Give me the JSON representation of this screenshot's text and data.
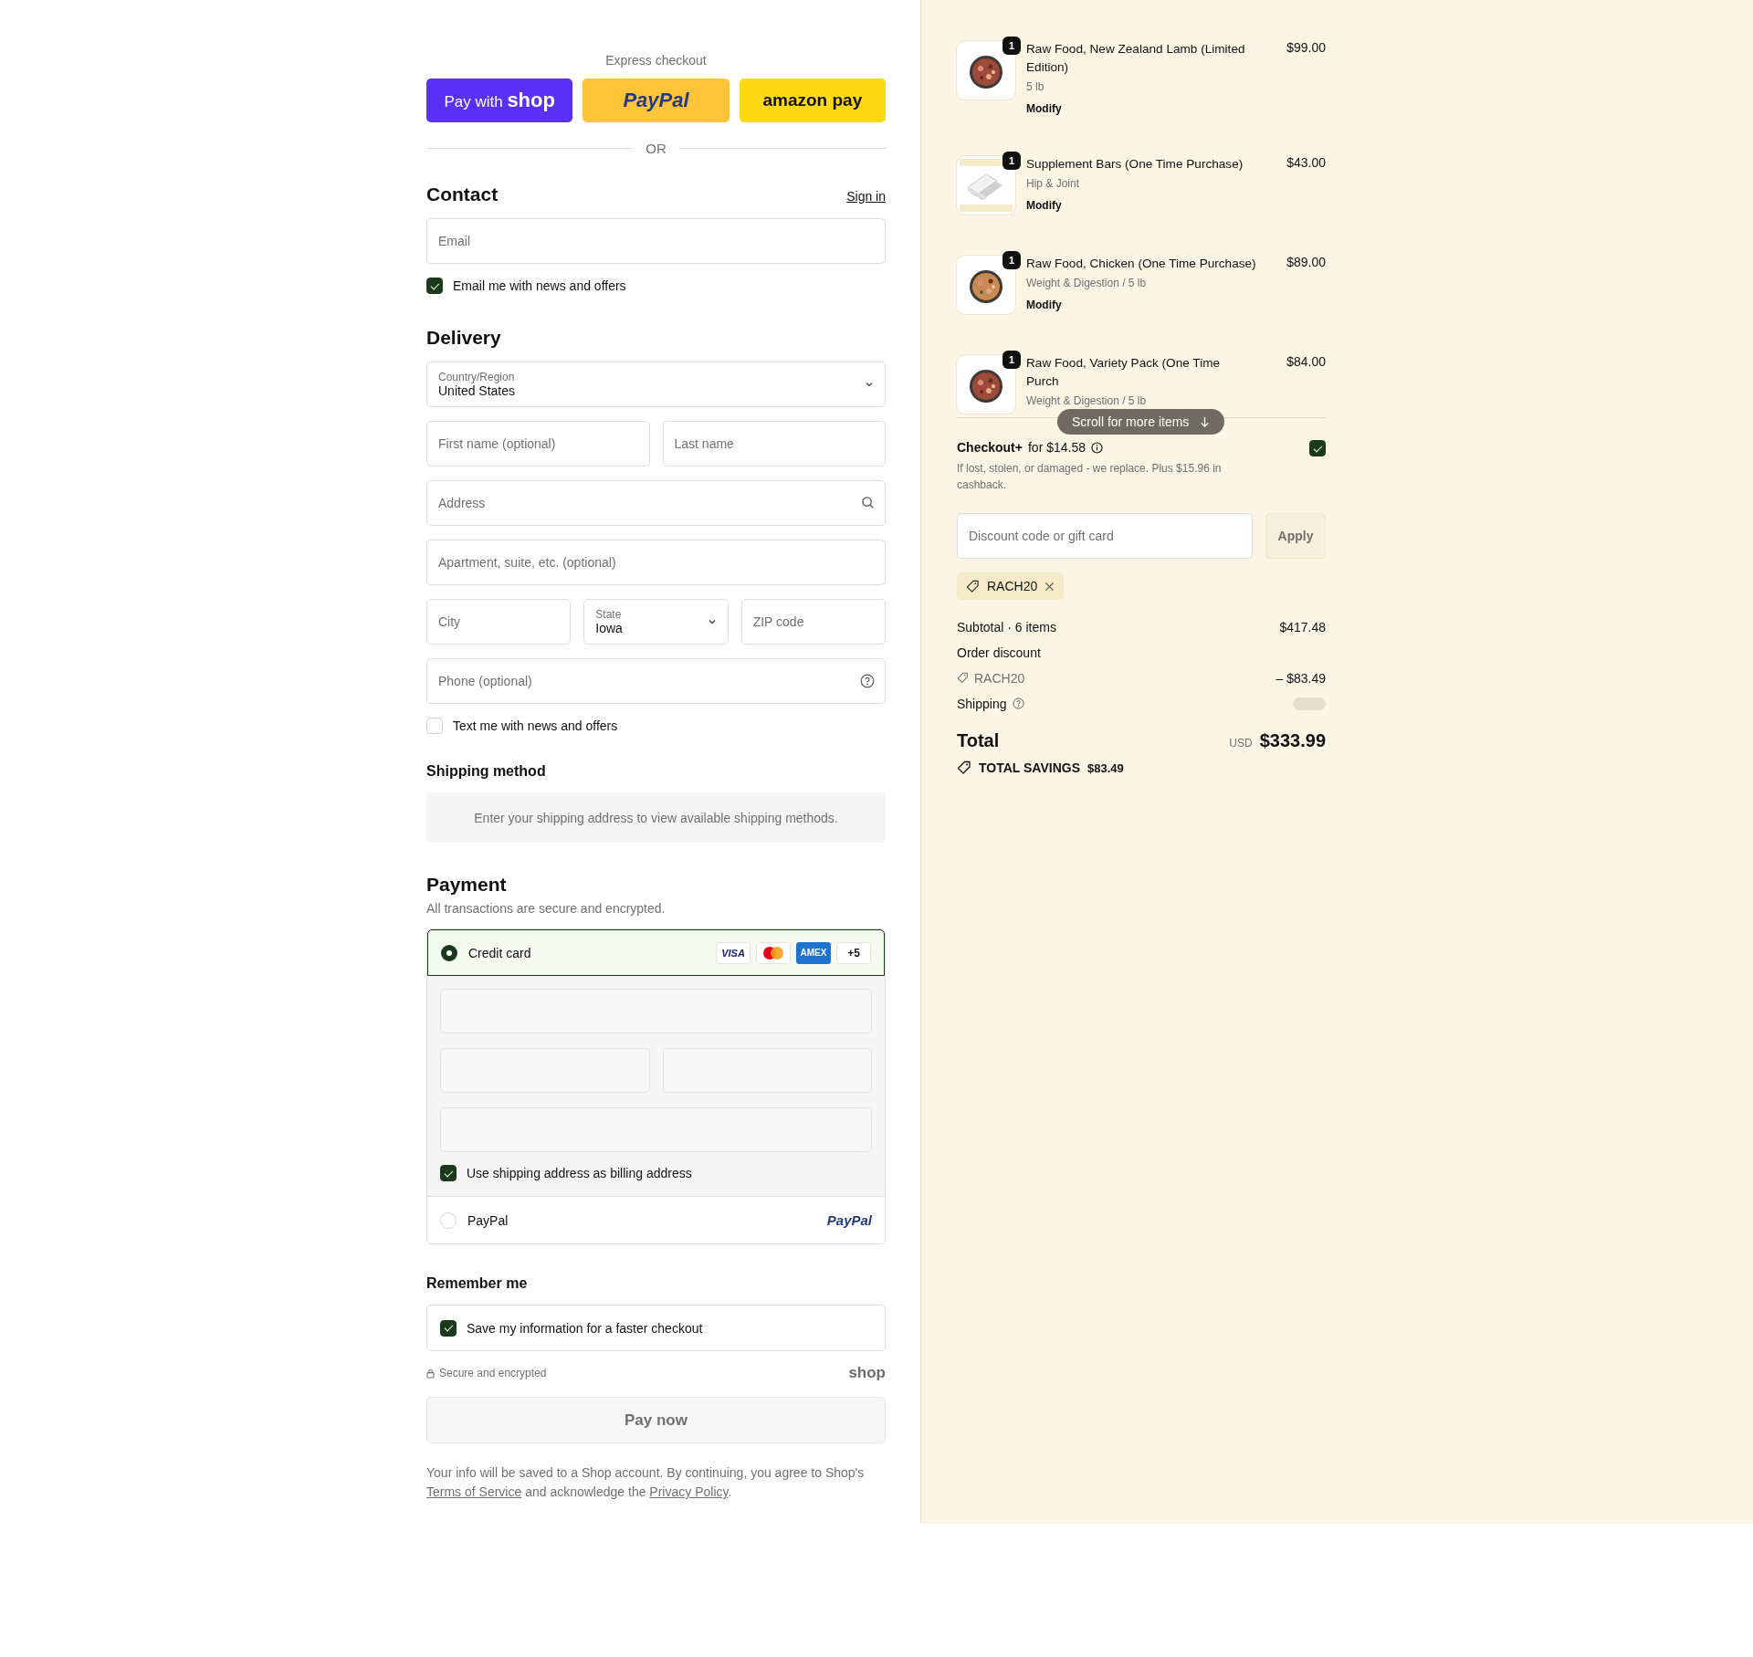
{
  "express": {
    "label": "Express checkout",
    "buttons": [
      {
        "kind": "shop",
        "text": "Pay with",
        "brand": "shop"
      },
      {
        "kind": "paypal",
        "text": "PayPal"
      },
      {
        "kind": "amazon",
        "text": "amazon pay"
      }
    ],
    "divider": "OR"
  },
  "contact": {
    "title": "Contact",
    "link": "Sign in",
    "email": {
      "placeholder": "Email"
    },
    "news": {
      "label": "Email me with news and offers",
      "checked": true
    }
  },
  "delivery": {
    "title": "Delivery",
    "rows": [
      [
        {
          "kind": "select",
          "label": "Country/Region",
          "value": "United States"
        }
      ],
      [
        {
          "kind": "text",
          "placeholder": "First name (optional)"
        },
        {
          "kind": "text",
          "placeholder": "Last name"
        }
      ],
      [
        {
          "kind": "search",
          "placeholder": "Address"
        }
      ],
      [
        {
          "kind": "text",
          "placeholder": "Apartment, suite, etc. (optional)"
        }
      ],
      [
        {
          "kind": "text",
          "placeholder": "City"
        },
        {
          "kind": "select",
          "label": "State",
          "value": "Iowa"
        },
        {
          "kind": "text",
          "placeholder": "ZIP code"
        }
      ],
      [
        {
          "kind": "help",
          "placeholder": "Phone (optional)"
        }
      ]
    ],
    "sms": {
      "label": "Text me with news and offers",
      "checked": false
    }
  },
  "shipping_method": {
    "title": "Shipping method",
    "notice": "Enter your shipping address to view available shipping methods."
  },
  "payment": {
    "title": "Payment",
    "subtitle": "All transactions are secure and encrypted.",
    "methods": [
      {
        "kind": "card",
        "label": "Credit card",
        "selected": true,
        "badges": [
          {
            "kind": "visa",
            "text": "VISA"
          },
          {
            "kind": "mastercard"
          },
          {
            "kind": "amex",
            "text": "AMEX"
          },
          {
            "kind": "more",
            "text": "+5"
          }
        ],
        "billing": {
          "label": "Use shipping address as billing address",
          "checked": true
        }
      },
      {
        "kind": "paypal",
        "label": "PayPal",
        "selected": false,
        "logo": "PayPal"
      }
    ]
  },
  "remember": {
    "title": "Remember me",
    "save": {
      "label": "Save my information for a faster checkout",
      "checked": true
    },
    "secure": "Secure and encrypted",
    "brand": "shop"
  },
  "pay_button": {
    "label": "Pay now",
    "disabled": true
  },
  "legal": {
    "before": "Your info will be saved to a Shop account. By continuing, you agree to Shop's",
    "terms": "Terms of Service",
    "middle": "and acknowledge the",
    "privacy": "Privacy Policy",
    "after": "."
  },
  "summary": {
    "items": [
      {
        "quantity": "1",
        "name": "Raw Food, New Zealand Lamb (Limited Edition)",
        "variant": "5 lb",
        "action": "Modify",
        "price": "$99.00"
      },
      {
        "quantity": "1",
        "name": "Supplement Bars (One Time Purchase)",
        "variant": "Hip & Joint",
        "action": "Modify",
        "price": "$43.00"
      },
      {
        "quantity": "1",
        "name": "Raw Food, Chicken (One Time Purchase)",
        "variant": "Weight & Digestion / 5 lb",
        "action": "Modify",
        "price": "$89.00"
      },
      {
        "quantity": "1",
        "name": "Raw Food, Variety Pack (One Time Purch",
        "variant": "Weight & Digestion / 5 lb",
        "price": "$84.00"
      }
    ],
    "scroll_hint": "Scroll for more items",
    "protection": {
      "name": "Checkout+",
      "price": "for $14.58",
      "description": "If lost, stolen, or damaged - we replace. Plus $15.96 in cashback.",
      "checked": true
    },
    "discount": {
      "placeholder": "Discount code or gift card",
      "button": "Apply"
    },
    "applied_code": "RACH20",
    "lines": [
      {
        "kind": "amount",
        "label": "Subtotal · 6 items",
        "value": "$417.48"
      },
      {
        "kind": "heading",
        "label": "Order discount"
      },
      {
        "kind": "code",
        "label": "RACH20",
        "value": "– $83.49"
      },
      {
        "kind": "pending",
        "label": "Shipping"
      }
    ],
    "total": {
      "label": "Total",
      "currency": "USD",
      "value": "$333.99"
    },
    "savings": {
      "label": "TOTAL SAVINGS",
      "value": "$83.49"
    }
  }
}
